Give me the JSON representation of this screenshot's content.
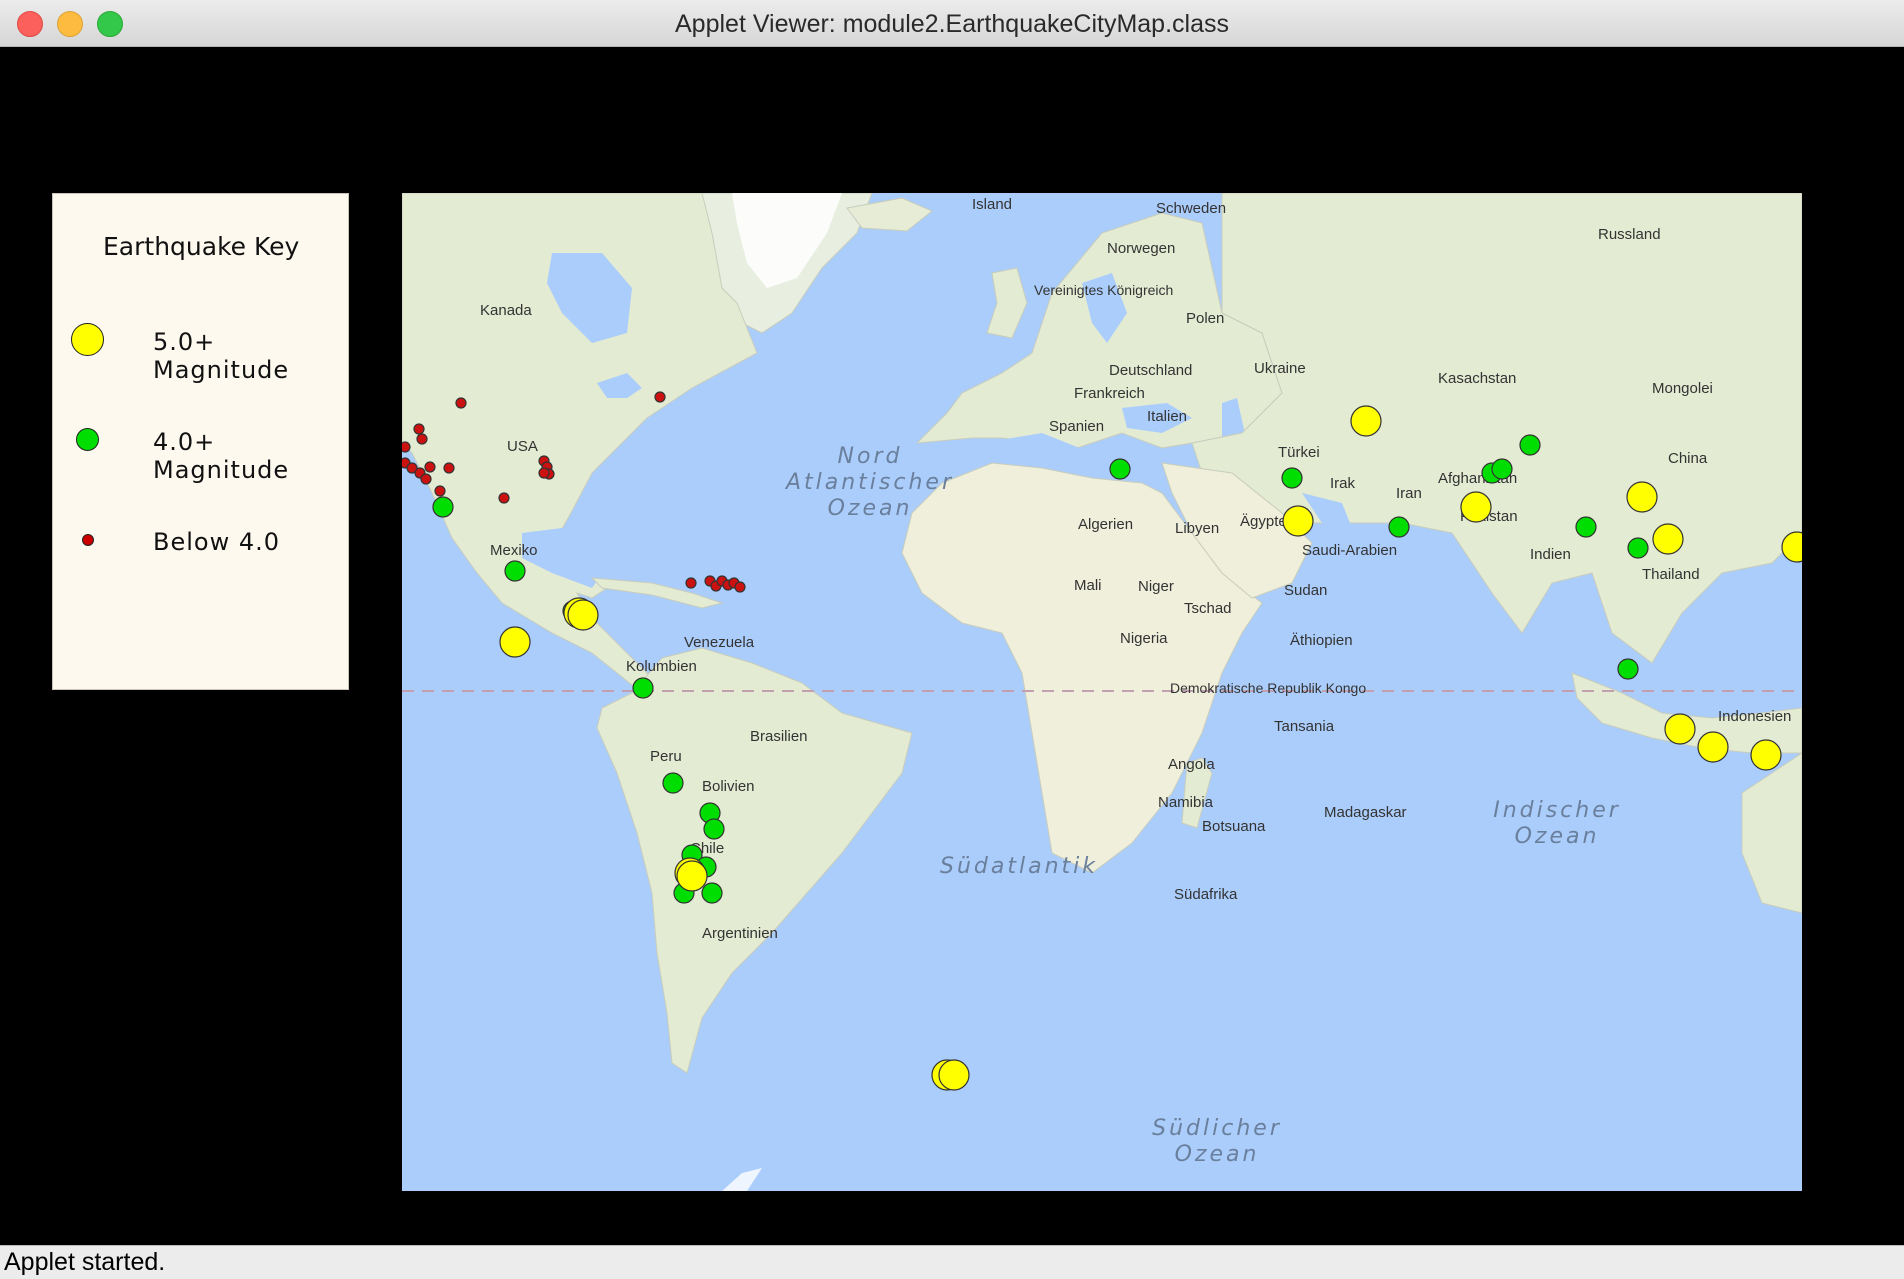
{
  "window": {
    "title": "Applet Viewer: module2.EarthquakeCityMap.class",
    "status": "Applet started."
  },
  "key": {
    "title": "Earthquake Key",
    "items": [
      {
        "label": "5.0+ Magnitude",
        "color": "#ffff00",
        "class": "large"
      },
      {
        "label": "4.0+ Magnitude",
        "color": "#00dd00",
        "class": "medium"
      },
      {
        "label": "Below 4.0",
        "color": "#cc0000",
        "class": "small"
      }
    ]
  },
  "map": {
    "ocean_color": "#abcdfb",
    "land_color": "#e4ebd3",
    "country_labels": [
      "Island",
      "Schweden",
      "Norwegen",
      "Russland",
      "Vereinigtes Königreich",
      "Kanada",
      "Polen",
      "Deutschland",
      "Ukraine",
      "Kasachstan",
      "Frankreich",
      "Mongolei",
      "Italien",
      "Spanien",
      "USA",
      "Türkei",
      "China",
      "Irak",
      "Iran",
      "Afghanistan",
      "Pakistan",
      "Algerien",
      "Libyen",
      "Ägypten",
      "Saudi-Arabien",
      "Indien",
      "Mexiko",
      "Thailand",
      "Mali",
      "Niger",
      "Sudan",
      "Tschad",
      "Nigeria",
      "Äthiopien",
      "Venezuela",
      "Kolumbien",
      "Demokratische Republik Kongo",
      "Tansania",
      "Indonesien",
      "Brasilien",
      "Peru",
      "Bolivien",
      "Angola",
      "Namibia",
      "Botsuana",
      "Madagaskar",
      "Chile",
      "Südafrika",
      "Argentinien"
    ],
    "ocean_labels": [
      "Nord Atlantischer Ozean",
      "Südatlantik",
      "Indischer Ozean",
      "Südlicher Ozean"
    ]
  }
}
